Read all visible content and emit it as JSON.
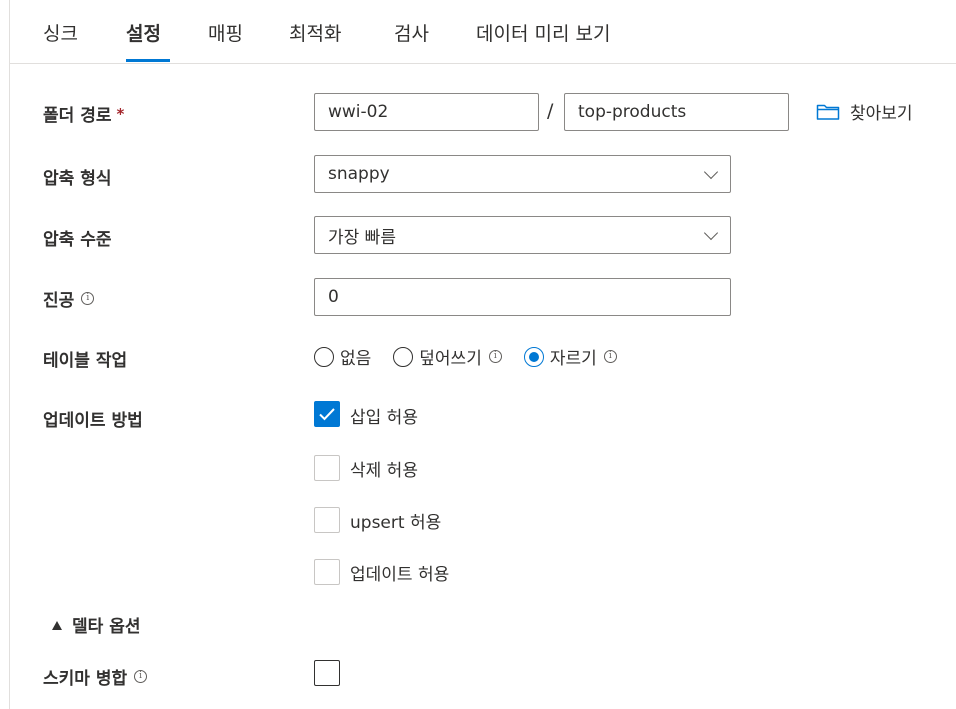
{
  "tabs": [
    {
      "label": "싱크",
      "active": false
    },
    {
      "label": "설정",
      "active": true
    },
    {
      "label": "매핑",
      "active": false
    },
    {
      "label": "최적화",
      "active": false
    },
    {
      "label": "검사",
      "active": false
    },
    {
      "label": "데이터 미리 보기",
      "active": false
    }
  ],
  "folder_path": {
    "label": "폴더 경로",
    "required_mark": "*",
    "container": "wwi-02",
    "separator": "/",
    "directory": "top-products",
    "browse_label": "찾아보기",
    "browse_icon": "folder-icon"
  },
  "compression_type": {
    "label": "압축 형식",
    "value": "snappy"
  },
  "compression_level": {
    "label": "압축 수준",
    "value": "가장 빠름"
  },
  "vacuum": {
    "label": "진공",
    "value": "0"
  },
  "table_action": {
    "label": "테이블 작업",
    "options": [
      {
        "label": "없음",
        "selected": false
      },
      {
        "label": "덮어쓰기",
        "selected": false
      },
      {
        "label": "자르기",
        "selected": true
      }
    ]
  },
  "update_method": {
    "label": "업데이트 방법",
    "options": [
      {
        "label": "삽입 허용",
        "checked": true
      },
      {
        "label": "삭제 허용",
        "checked": false
      },
      {
        "label": "upsert 허용",
        "checked": false
      },
      {
        "label": "업데이트 허용",
        "checked": false
      }
    ]
  },
  "delta_options": {
    "label": "델타 옵션",
    "expanded": true
  },
  "merge_schema": {
    "label": "스키마 병합",
    "checked": false
  },
  "info_glyph": "i",
  "colors": {
    "accent": "#0078d4",
    "text": "#323130",
    "border": "#8a8886",
    "required": "#a4262c"
  }
}
